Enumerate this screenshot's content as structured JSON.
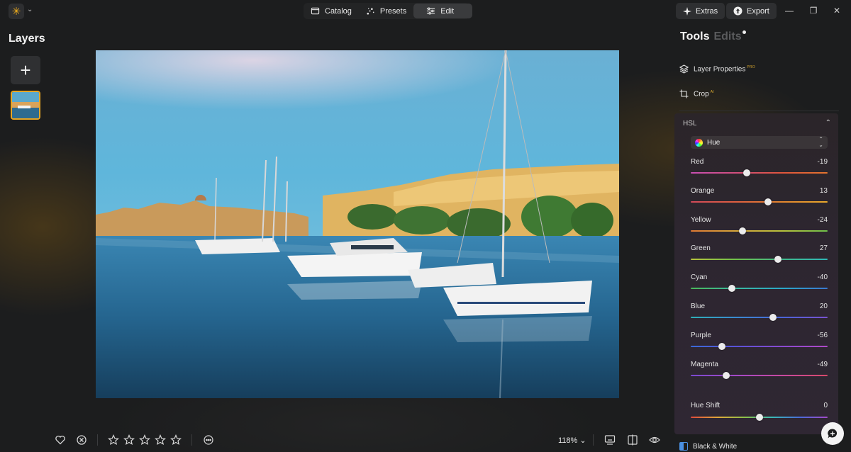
{
  "topbar": {
    "logo_icon": "sun-logo-icon",
    "modes": [
      {
        "label": "Catalog",
        "icon": "catalog-icon",
        "active": false
      },
      {
        "label": "Presets",
        "icon": "presets-icon",
        "active": false
      },
      {
        "label": "Edit",
        "icon": "sliders-icon",
        "active": true
      }
    ],
    "extras_label": "Extras",
    "export_label": "Export"
  },
  "layers": {
    "title": "Layers",
    "add_icon": "plus-icon"
  },
  "bottombar": {
    "zoom": "118%",
    "rating_stars": 5,
    "filled_stars": 0
  },
  "panel": {
    "tab_tools": "Tools",
    "tab_edits": "Edits",
    "tools": [
      {
        "label": "Layer Properties",
        "badge": "PRO",
        "icon": "layers-icon"
      },
      {
        "label": "Crop",
        "badge": "AI",
        "icon": "crop-icon"
      }
    ],
    "hsl": {
      "title": "HSL",
      "mode": "Hue",
      "sliders": [
        {
          "label": "Red",
          "value": "-19",
          "pos": 0.41,
          "grad": "linear-gradient(90deg,#c94fb4,#d24f7d,#e0553c,#e3752e)"
        },
        {
          "label": "Orange",
          "value": "13",
          "pos": 0.565,
          "grad": "linear-gradient(90deg,#d24a5a,#e06040,#e3862e,#e9a92c)"
        },
        {
          "label": "Yellow",
          "value": "-24",
          "pos": 0.38,
          "grad": "linear-gradient(90deg,#e07a34,#d8a83a,#b8c23c,#6fc04a)"
        },
        {
          "label": "Green",
          "value": "27",
          "pos": 0.635,
          "grad": "linear-gradient(90deg,#b8c23c,#6fc04a,#3fb88a,#2fb8b8)"
        },
        {
          "label": "Cyan",
          "value": "-40",
          "pos": 0.3,
          "grad": "linear-gradient(90deg,#4ab85a,#3ab8a0,#2aa8c8,#3a78d0)"
        },
        {
          "label": "Blue",
          "value": "20",
          "pos": 0.6,
          "grad": "linear-gradient(90deg,#2fb0b8,#3a8ad0,#4a64d8,#7a52d0)"
        },
        {
          "label": "Purple",
          "value": "-56",
          "pos": 0.23,
          "grad": "linear-gradient(90deg,#3a6ad8,#5a52d8,#8a4ad0,#b04ac8)"
        },
        {
          "label": "Magenta",
          "value": "-49",
          "pos": 0.26,
          "grad": "linear-gradient(90deg,#7a4ad0,#a44ac8,#c84aa0,#d84a6a)"
        }
      ],
      "hue_shift": {
        "label": "Hue Shift",
        "value": "0",
        "pos": 0.5
      }
    },
    "bw_label": "Black & White"
  },
  "colors": {
    "accent": "#e8a623",
    "panel_bg": "#2d2630"
  }
}
